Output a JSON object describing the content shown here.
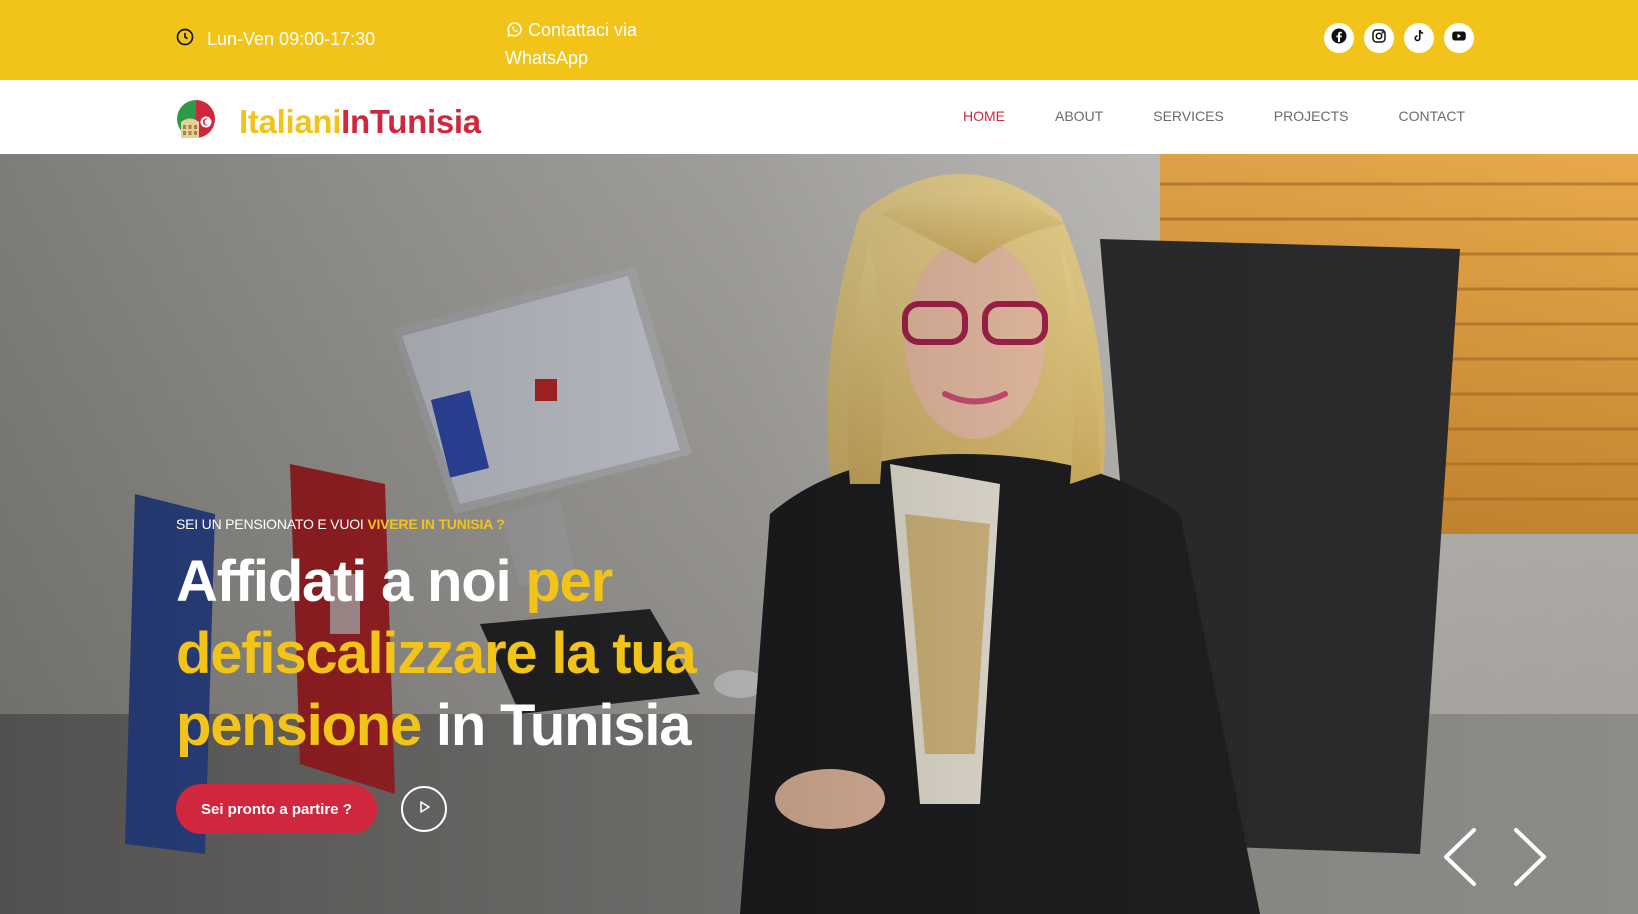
{
  "topbar": {
    "hours": "Lun-Ven 09:00-17:30",
    "whatsapp": "Contattaci via WhatsApp",
    "background": "#f2c419",
    "socials": [
      {
        "icon": "facebook-icon"
      },
      {
        "icon": "instagram-icon"
      },
      {
        "icon": "tiktok-icon"
      },
      {
        "icon": "youtube-icon"
      }
    ]
  },
  "header": {
    "logo": {
      "part1": "Italiani",
      "part2": "InTunisia"
    },
    "nav": [
      {
        "label": "HOME",
        "active": true
      },
      {
        "label": "ABOUT"
      },
      {
        "label": "SERVICES"
      },
      {
        "label": "PROJECTS"
      },
      {
        "label": "CONTACT"
      }
    ]
  },
  "hero": {
    "eyebrow": "SEI UN PENSIONATO E VUOI",
    "eyebrow_highlight": "VIVERE IN TUNISIA ?",
    "headline": {
      "part1": "Affidati a noi",
      "part2": "per defiscalizzare la tua pensione",
      "part3": "in Tunisia"
    },
    "cta": "Sei pronto a partire ?",
    "icons": {
      "play": "play-icon",
      "prev": "chevron-left-icon",
      "next": "chevron-right-icon"
    }
  },
  "colors": {
    "brand_yellow": "#f2c419",
    "brand_red": "#d0273f",
    "nav_text": "#6b6b6b"
  }
}
